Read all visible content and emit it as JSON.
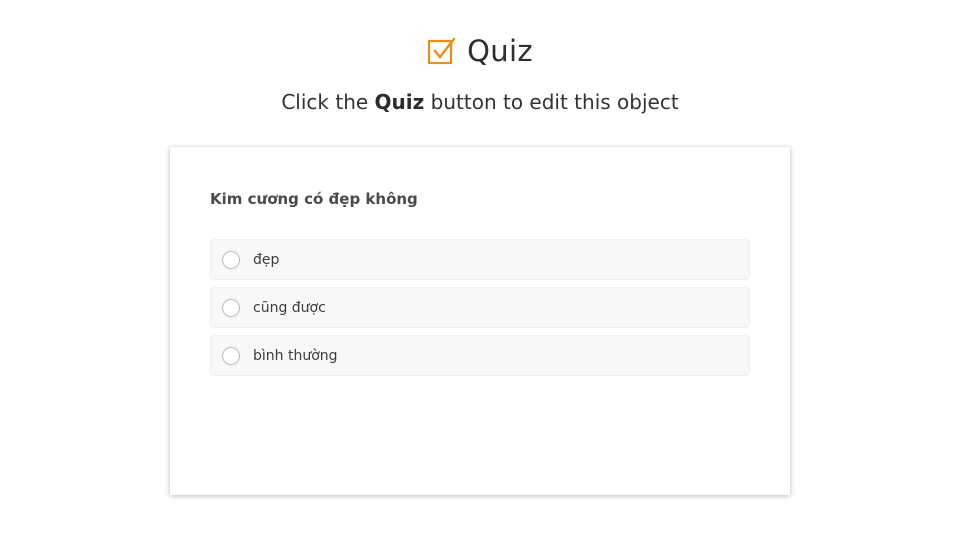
{
  "header": {
    "icon": "checkbox-checked-icon",
    "title": "Quiz",
    "accent_color": "#f08c12"
  },
  "subtitle": {
    "prefix": "Click the",
    "emphasis": "Quiz",
    "suffix": "button to edit this object"
  },
  "quiz": {
    "question": "Kim cương có đẹp không",
    "options": [
      {
        "label": "đẹp",
        "selected": false
      },
      {
        "label": "cũng được",
        "selected": false
      },
      {
        "label": "bình thường",
        "selected": false
      }
    ]
  }
}
